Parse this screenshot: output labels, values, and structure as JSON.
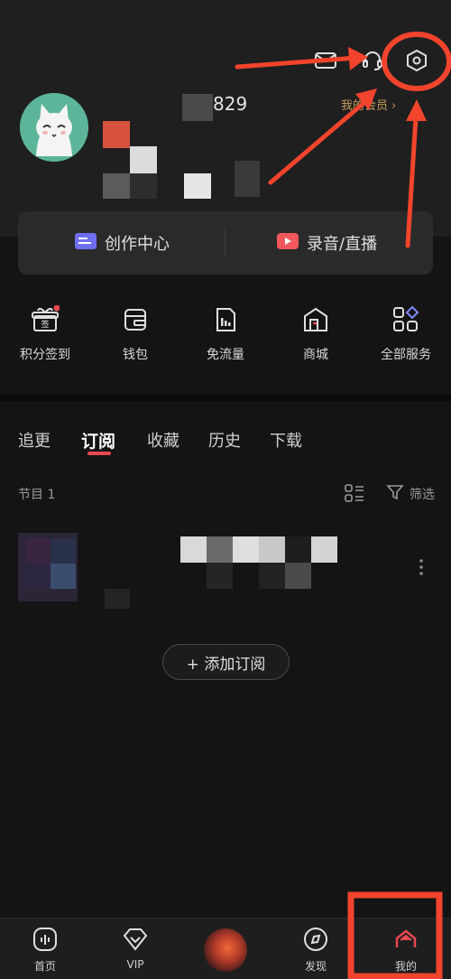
{
  "profile": {
    "username_suffix": "829",
    "vip_link": "我的会员 ›"
  },
  "quick_actions": {
    "creation_center": "创作中心",
    "record_live": "录音/直播"
  },
  "services": [
    {
      "label": "积分签到",
      "icon": "gift-icon",
      "badge_text": "签"
    },
    {
      "label": "钱包",
      "icon": "wallet-icon"
    },
    {
      "label": "免流量",
      "icon": "free-data-icon"
    },
    {
      "label": "商城",
      "icon": "shop-icon"
    },
    {
      "label": "全部服务",
      "icon": "all-services-icon"
    }
  ],
  "tabs": [
    {
      "label": "追更"
    },
    {
      "label": "订阅"
    },
    {
      "label": "收藏"
    },
    {
      "label": "历史"
    },
    {
      "label": "下载"
    }
  ],
  "list": {
    "count_label": "节目 1",
    "filter_label": "筛选",
    "add_subscription": "+ 添加订阅"
  },
  "bottom_nav": [
    {
      "label": "首页",
      "icon": "home-icon"
    },
    {
      "label": "VIP",
      "icon": "vip-diamond-icon"
    },
    {
      "label": "",
      "icon": "now-playing-icon"
    },
    {
      "label": "发现",
      "icon": "discover-icon"
    },
    {
      "label": "我的",
      "icon": "profile-icon"
    }
  ],
  "colors": {
    "accent": "#e8484f",
    "annotation": "#f2442c",
    "vip_gold": "#c79b5a"
  }
}
